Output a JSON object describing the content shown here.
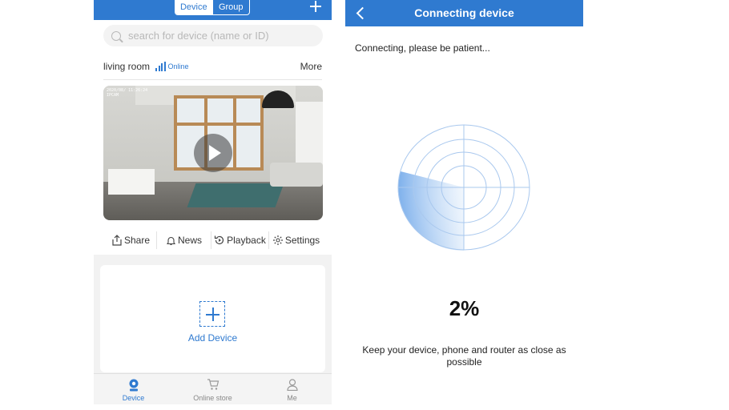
{
  "left": {
    "header": {
      "tabs": [
        {
          "label": "Device",
          "active": true
        },
        {
          "label": "Group",
          "active": false
        }
      ],
      "add_icon": "plus-icon"
    },
    "search": {
      "placeholder": "search for device (name or ID)"
    },
    "device": {
      "name": "living room",
      "status": "Online",
      "more_label": "More",
      "video_timestamp": "2020/08/ 11:26:24",
      "video_channel": "IPCAM"
    },
    "actions": [
      {
        "label": "Share",
        "icon": "share-icon"
      },
      {
        "label": "News",
        "icon": "bell-icon"
      },
      {
        "label": "Playback",
        "icon": "playback-icon"
      },
      {
        "label": "Settings",
        "icon": "gear-icon"
      }
    ],
    "add_device": {
      "label": "Add Device"
    },
    "tabbar": [
      {
        "label": "Device",
        "icon": "camera-icon",
        "active": true
      },
      {
        "label": "Online store",
        "icon": "cart-icon",
        "active": false
      },
      {
        "label": "Me",
        "icon": "person-icon",
        "active": false
      }
    ]
  },
  "right": {
    "title": "Connecting device",
    "subtitle": "Connecting, please be patient...",
    "progress": "2%",
    "hint": "Keep your device, phone and router as close as possible"
  },
  "colors": {
    "accent": "#2f7ad0",
    "background": "#ffffff",
    "tab_bg": "#f4f4f4"
  }
}
